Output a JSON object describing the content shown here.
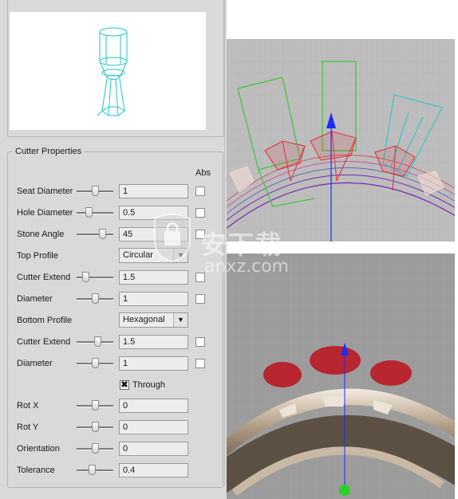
{
  "cutter_properties": {
    "title": "Cutter Properties",
    "abs_label": "Abs",
    "rows": [
      {
        "label": "Seat Diameter",
        "value": "1",
        "slider": 0.5
      },
      {
        "label": "Hole Diameter",
        "value": "0.5",
        "slider": 0.3
      },
      {
        "label": "Stone Angle",
        "value": "45",
        "slider": 0.75
      },
      {
        "label": "Top Profile",
        "value": "Circular"
      },
      {
        "label": "Cutter Extend",
        "value": "1.5",
        "slider": 0.2
      },
      {
        "label": "Diameter",
        "value": "1",
        "slider": 0.5
      },
      {
        "label": "Bottom Profile",
        "value": "Hexagonal"
      },
      {
        "label": "Cutter Extend",
        "value": "1.5",
        "slider": 0.6
      },
      {
        "label": "Diameter",
        "value": "1",
        "slider": 0.5
      },
      {
        "label": "Rot X",
        "value": "0",
        "slider": 0.5
      },
      {
        "label": "Rot Y",
        "value": "0",
        "slider": 0.5
      },
      {
        "label": "Orientation",
        "value": "0",
        "slider": 0.5
      },
      {
        "label": "Tolerance",
        "value": "0.4",
        "slider": 0.4
      }
    ],
    "through_label": "Through",
    "through_checked": true,
    "dropdown_arrow": "▼"
  },
  "watermark": {
    "text_cn": "安下载",
    "url": "anxz.com"
  },
  "colors": {
    "panel_bg": "#d9d9d9",
    "wire_cyan": "#1fc2cc",
    "gem_red": "#e0303a",
    "ring_purple": "#7a28b0",
    "guide_green": "#3dc43d",
    "axis_blue": "#1a2cff"
  },
  "icons": {
    "check": "check-icon",
    "dropdown": "chevron-down-icon"
  }
}
